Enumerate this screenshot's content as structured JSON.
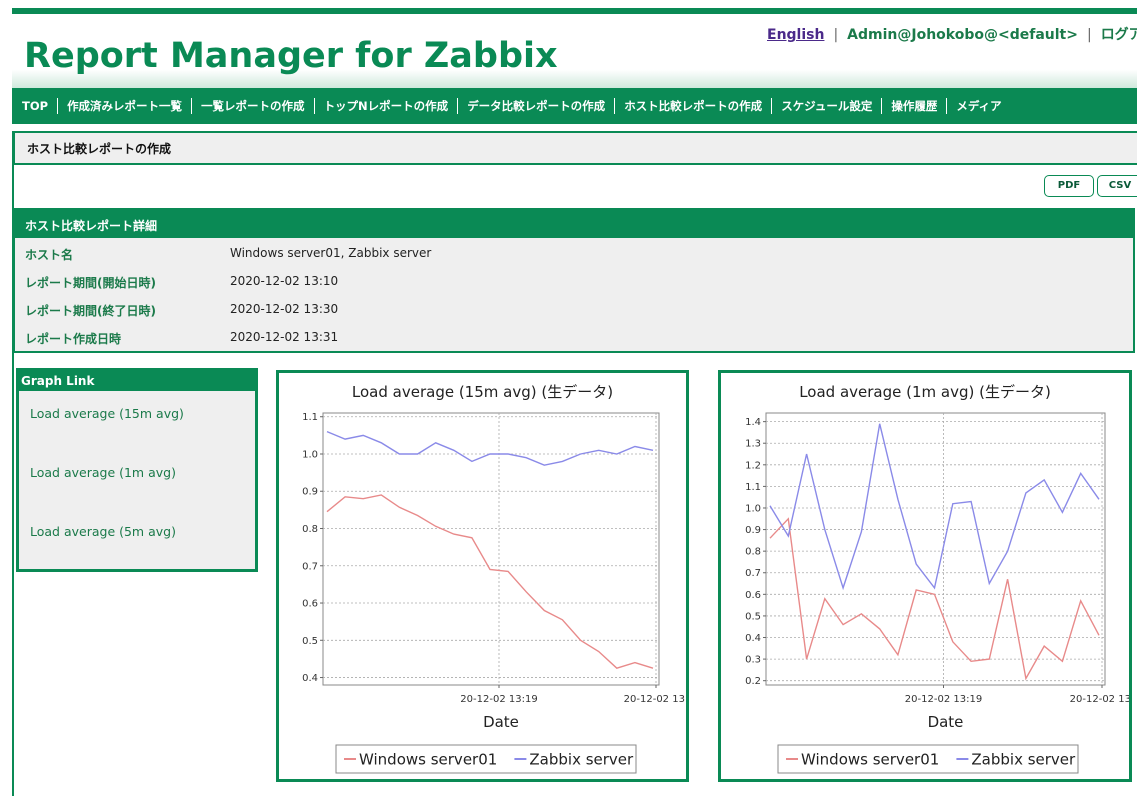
{
  "header": {
    "logo": "Report Manager for Zabbix",
    "lang_link": "English",
    "user": "Admin@Johokobo@<default>",
    "logout": "ログアウト"
  },
  "nav": [
    "TOP",
    "作成済みレポート一覧",
    "一覧レポートの作成",
    "トップNレポートの作成",
    "データ比較レポートの作成",
    "ホスト比較レポートの作成",
    "スケジュール設定",
    "操作履歴",
    "メディア"
  ],
  "page_title": "ホスト比較レポートの作成",
  "buttons": {
    "pdf": "PDF",
    "csv": "CSV"
  },
  "detail": {
    "title": "ホスト比較レポート詳細",
    "rows": [
      {
        "label": "ホスト名",
        "value": "Windows server01, Zabbix server"
      },
      {
        "label": "レポート期間(開始日時)",
        "value": "2020-12-02 13:10"
      },
      {
        "label": "レポート期間(終了日時)",
        "value": "2020-12-02 13:30"
      },
      {
        "label": "レポート作成日時",
        "value": "2020-12-02 13:31"
      }
    ]
  },
  "graph_link": {
    "title": "Graph Link",
    "items": [
      "Load average (15m avg)",
      "Load average (1m avg)",
      "Load average (5m avg)"
    ]
  },
  "colors": {
    "accent": "#0a8a55",
    "series_windows": "#e88a8a",
    "series_zabbix": "#8a8ae8"
  },
  "chart_data": [
    {
      "type": "line",
      "title": "Load average (15m avg) (生データ)",
      "xlabel": "Date",
      "ylabel": "",
      "ylim": [
        0.38,
        1.11
      ],
      "yticks": [
        "0.4",
        "0.5",
        "0.6",
        "0.7",
        "0.8",
        "0.9",
        "1.0",
        "1.1"
      ],
      "xticks": [
        "20-12-02 13:19",
        "20-12-02 13:"
      ],
      "grid": true,
      "legend": "bottom",
      "series": [
        {
          "name": "Windows server01",
          "color": "#e88a8a",
          "values": [
            0.845,
            0.885,
            0.88,
            0.89,
            0.857,
            0.835,
            0.806,
            0.785,
            0.775,
            0.69,
            0.685,
            0.63,
            0.58,
            0.555,
            0.5,
            0.47,
            0.425,
            0.44,
            0.425
          ]
        },
        {
          "name": "Zabbix server",
          "color": "#8a8ae8",
          "values": [
            1.06,
            1.04,
            1.05,
            1.03,
            1.0,
            1.0,
            1.03,
            1.01,
            0.98,
            1.0,
            1.0,
            0.99,
            0.97,
            0.98,
            1.0,
            1.01,
            1.0,
            1.02,
            1.01
          ]
        }
      ]
    },
    {
      "type": "line",
      "title": "Load average (1m avg) (生データ)",
      "xlabel": "Date",
      "ylabel": "",
      "ylim": [
        0.18,
        1.44
      ],
      "yticks": [
        "0.2",
        "0.3",
        "0.4",
        "0.5",
        "0.6",
        "0.7",
        "0.8",
        "0.9",
        "1.0",
        "1.1",
        "1.2",
        "1.3",
        "1.4"
      ],
      "xticks": [
        "20-12-02 13:19",
        "20-12-02 13:"
      ],
      "grid": true,
      "legend": "bottom",
      "series": [
        {
          "name": "Windows server01",
          "color": "#e88a8a",
          "values": [
            0.86,
            0.95,
            0.3,
            0.58,
            0.46,
            0.51,
            0.44,
            0.32,
            0.62,
            0.6,
            0.38,
            0.29,
            0.3,
            0.67,
            0.21,
            0.36,
            0.29,
            0.57,
            0.41
          ]
        },
        {
          "name": "Zabbix server",
          "color": "#8a8ae8",
          "values": [
            1.01,
            0.87,
            1.25,
            0.9,
            0.63,
            0.89,
            1.39,
            1.04,
            0.74,
            0.63,
            1.02,
            1.03,
            0.65,
            0.8,
            1.07,
            1.13,
            0.98,
            1.16,
            1.04
          ]
        }
      ]
    }
  ]
}
